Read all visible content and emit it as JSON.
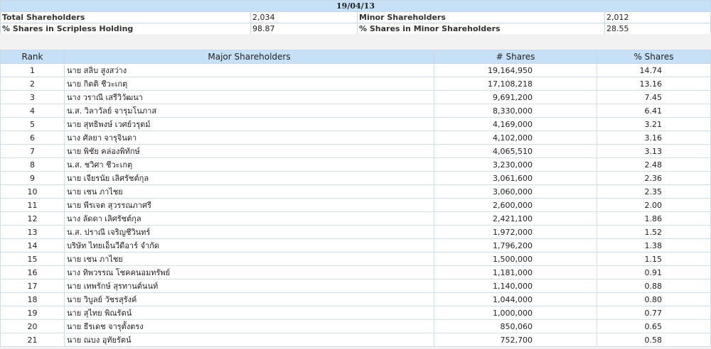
{
  "summary": {
    "date": "19/04/13",
    "total_shareholders_label": "Total Shareholders",
    "total_shareholders_value": "2,034",
    "minor_shareholders_label": "Minor Shareholders",
    "minor_shareholders_value": "2,012",
    "scripless_label": "% Shares in Scripless Holding",
    "scripless_value": "98.87",
    "minor_pct_label": "% Shares in Minor Shareholders",
    "minor_pct_value": "28.55"
  },
  "major": {
    "headers": [
      "Rank",
      "Major Shareholders",
      "# Shares",
      "% Shares"
    ],
    "rows": [
      {
        "rank": "1",
        "name": "นาย สลิบ สูงสว่าง",
        "shares": "19,164,950",
        "pct": "14.74"
      },
      {
        "rank": "2",
        "name": "นาย กิตติ ชีวะเกตุ",
        "shares": "17,108,218",
        "pct": "13.16"
      },
      {
        "rank": "3",
        "name": "นาง วราณี เสรีวิวัฒนา",
        "shares": "9,691,200",
        "pct": "7.45"
      },
      {
        "rank": "4",
        "name": "น.ส. วิลาวัลย์ จารุมโนภาส",
        "shares": "8,330,000",
        "pct": "6.41"
      },
      {
        "rank": "5",
        "name": "นาย สุทธิพงษ์ เวศย์วรุตม์",
        "shares": "4,169,000",
        "pct": "3.21"
      },
      {
        "rank": "6",
        "name": "นาง ศัลยา จารุจินดา",
        "shares": "4,102,000",
        "pct": "3.16"
      },
      {
        "rank": "7",
        "name": "นาย พิชัย คล่องพิทักษ์",
        "shares": "4,065,510",
        "pct": "3.13"
      },
      {
        "rank": "8",
        "name": "น.ส. ชวิศา ชีวะเกตุ",
        "shares": "3,230,000",
        "pct": "2.48"
      },
      {
        "rank": "9",
        "name": "นาย เจียรนัย เลิศรัชต์กุล",
        "shares": "3,061,600",
        "pct": "2.36"
      },
      {
        "rank": "10",
        "name": "นาย เชน ภาไชย",
        "shares": "3,060,000",
        "pct": "2.35"
      },
      {
        "rank": "11",
        "name": "นาย พีรเจต สุวรรณภาศรี",
        "shares": "2,600,000",
        "pct": "2.00"
      },
      {
        "rank": "12",
        "name": "นาง ลัดดา เลิศรัชต์กุล",
        "shares": "2,421,100",
        "pct": "1.86"
      },
      {
        "rank": "13",
        "name": "น.ส. ปราณี เจริญชีวินทร์",
        "shares": "1,972,000",
        "pct": "1.52"
      },
      {
        "rank": "14",
        "name": "บริษัท ไทยเอ็นวีดีอาร์ จำกัด",
        "shares": "1,796,200",
        "pct": "1.38"
      },
      {
        "rank": "15",
        "name": "นาย เชน ภาไชย",
        "shares": "1,500,000",
        "pct": "1.15"
      },
      {
        "rank": "16",
        "name": "นาง ทิพวรรณ โชคคนอมทรัพย์",
        "shares": "1,181,000",
        "pct": "0.91"
      },
      {
        "rank": "17",
        "name": "นาย เทพรักษ์ สุรทานต์นนท์",
        "shares": "1,140,000",
        "pct": "0.88"
      },
      {
        "rank": "18",
        "name": "นาย วิบูลย์ วัชรสุรังค์",
        "shares": "1,044,000",
        "pct": "0.80"
      },
      {
        "rank": "19",
        "name": "นาย สุไทย พิณรัตน์",
        "shares": "1,000,000",
        "pct": "0.77"
      },
      {
        "rank": "20",
        "name": "นาย ธีรเดช จารุตั้งตรง",
        "shares": "850,060",
        "pct": "0.65"
      },
      {
        "rank": "21",
        "name": "นาย ณบง อุทัยรัตน์",
        "shares": "752,700",
        "pct": "0.58"
      }
    ]
  }
}
